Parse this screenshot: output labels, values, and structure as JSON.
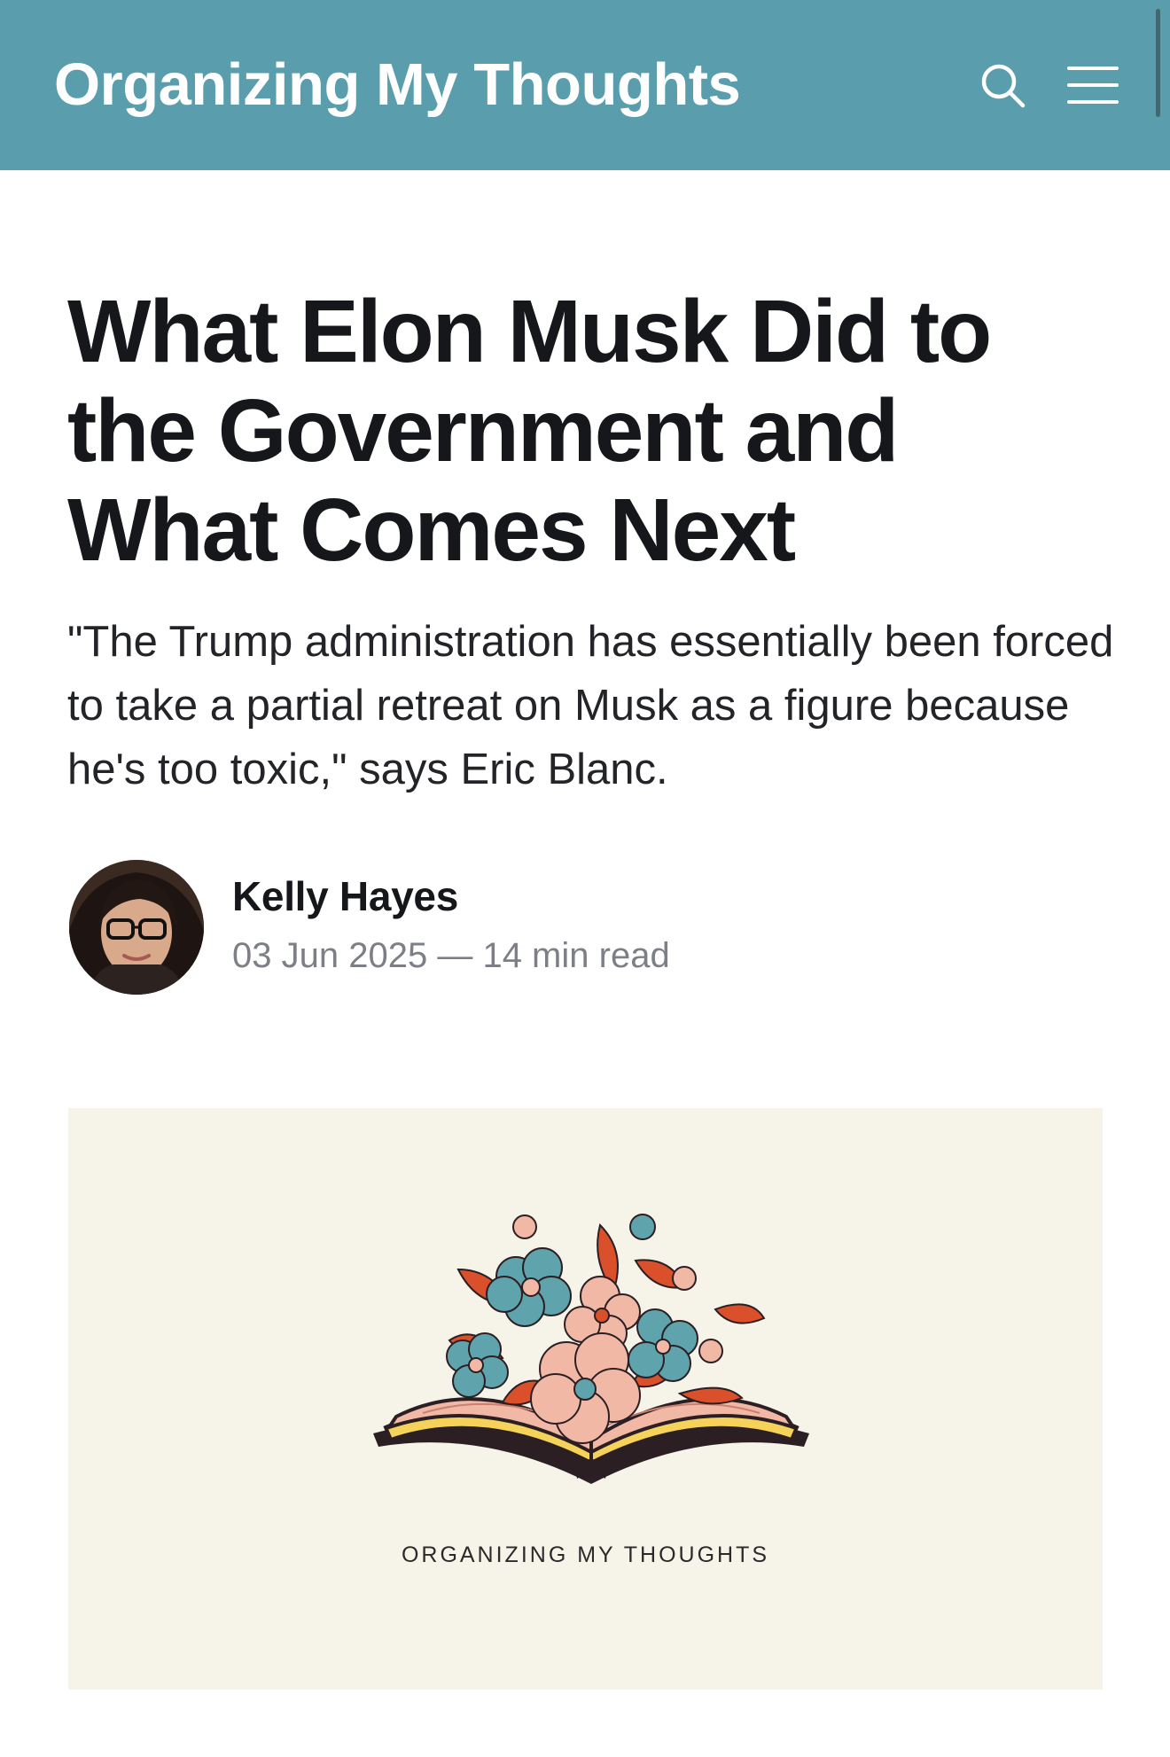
{
  "header": {
    "site_title": "Organizing My Thoughts",
    "search_icon": "search-icon",
    "menu_icon": "hamburger-menu-icon",
    "background_color": "#5a9eae"
  },
  "article": {
    "title": "What Elon Musk Did to the Government and What Comes Next",
    "excerpt": "\"The Trump administration has essentially been forced to take a partial retreat on Musk as a figure because he's too toxic,\" says Eric Blanc.",
    "author": {
      "name": "Kelly Hayes",
      "avatar_icon": "author-avatar"
    },
    "date": "03 Jun 2025",
    "separator": "—",
    "read_time": "14 min read"
  },
  "feature_image": {
    "caption": "ORGANIZING MY THOUGHTS",
    "background_color": "#f6f4e8",
    "colors": {
      "teal": "#5fa3ad",
      "red_orange": "#d9502b",
      "pink": "#f2b8a6",
      "yellow": "#f5d35a",
      "dark": "#2b1f24"
    }
  }
}
